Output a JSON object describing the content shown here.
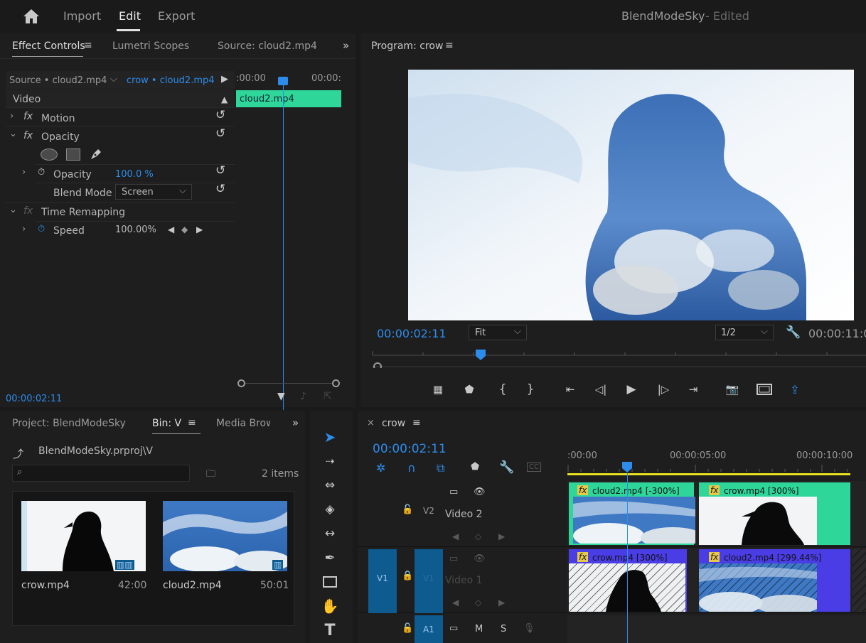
{
  "app": {
    "top_tabs": [
      "Import",
      "Edit",
      "Export"
    ],
    "active_tab": "Edit",
    "project_name": "BlendModeSky",
    "edited_label": "- Edited"
  },
  "effect_controls": {
    "tabs": [
      "Effect Controls",
      "Lumetri Scopes",
      "Source: cloud2.mp4"
    ],
    "source_label": "Source • cloud2.mp4",
    "sequence_clip": "crow • cloud2.mp4",
    "ruler_start": ":00:00",
    "ruler_end": "00:00:",
    "clip_name": "cloud2.mp4",
    "video_header": "Video",
    "motion": "Motion",
    "opacity_group": "Opacity",
    "opacity_label": "Opacity",
    "opacity_value": "100.0 %",
    "blend_mode_label": "Blend Mode",
    "blend_mode_value": "Screen",
    "time_remapping": "Time Remapping",
    "speed_label": "Speed",
    "speed_value": "100.00%",
    "timecode": "00:00:02:11"
  },
  "program": {
    "title": "Program: crow",
    "timecode": "00:00:02:11",
    "fit": "Fit",
    "resolution": "1/2",
    "duration": "00:00:11:0"
  },
  "project": {
    "tabs": [
      "Project: BlendModeSky",
      "Bin: V",
      "Media Brow"
    ],
    "path": "BlendModeSky.prproj\\V",
    "search_placeholder": "",
    "item_count": "2 items",
    "items": [
      {
        "name": "crow.mp4",
        "duration": "42:00"
      },
      {
        "name": "cloud2.mp4",
        "duration": "50:01"
      }
    ]
  },
  "timeline": {
    "sequence": "crow",
    "timecode": "00:00:02:11",
    "ruler": [
      ":00:00",
      "00:00:05:00",
      "00:00:10:00"
    ],
    "tracks": {
      "v2": {
        "target": "V2",
        "name": "Video 2"
      },
      "v1": {
        "source": "V1",
        "target": "V1",
        "name": "Video 1"
      },
      "a1": {
        "target": "A1",
        "m": "M",
        "s": "S"
      }
    },
    "clips": {
      "v2_a": "cloud2.mp4 [-300%]",
      "v2_b": "crow.mp4 [300%]",
      "v1_a": "crow.mp4 [300%]",
      "v1_b": "cloud2.mp4 [299.44%]"
    }
  },
  "colors": {
    "accent_blue": "#2d8ceb",
    "clip_green": "#2fd69a",
    "clip_purple": "#4b3de6",
    "track_blue": "#0d5b8f",
    "work_area_yellow": "#e6e01e"
  }
}
